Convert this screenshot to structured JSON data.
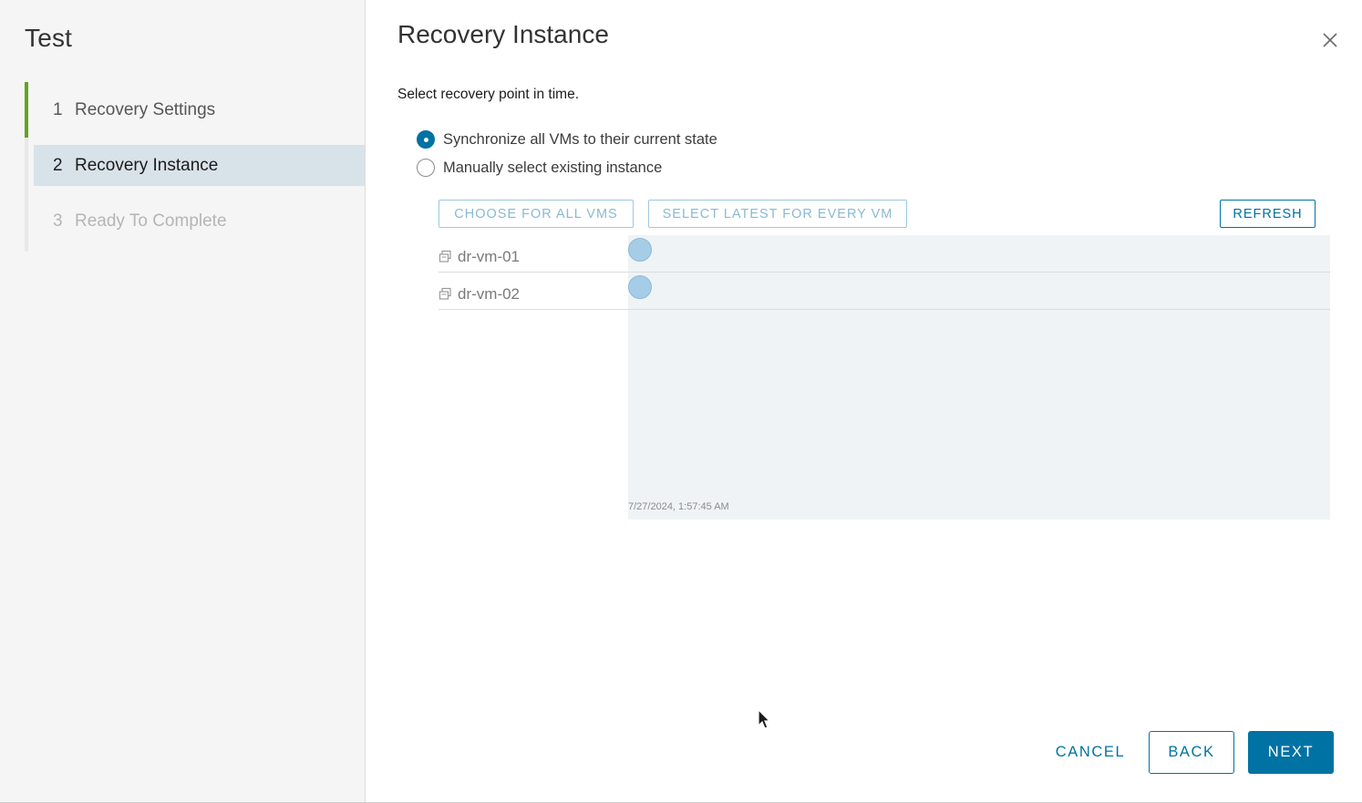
{
  "wizard": {
    "title": "Test",
    "steps": [
      {
        "number": "1",
        "label": "Recovery Settings",
        "state": "completed"
      },
      {
        "number": "2",
        "label": "Recovery Instance",
        "state": "current"
      },
      {
        "number": "3",
        "label": "Ready To Complete",
        "state": "disabled"
      }
    ]
  },
  "main": {
    "title": "Recovery Instance",
    "close_icon": "close-icon",
    "instruction": "Select recovery point in time.",
    "options": [
      {
        "label": "Synchronize all VMs to their current state",
        "checked": true
      },
      {
        "label": "Manually select existing instance",
        "checked": false
      }
    ],
    "toolbar": {
      "choose_all": "CHOOSE FOR ALL VMS",
      "select_latest": "SELECT LATEST FOR EVERY VM",
      "refresh": "REFRESH"
    },
    "vms": [
      {
        "name": "dr-vm-01",
        "icon": "vm-icon"
      },
      {
        "name": "dr-vm-02",
        "icon": "vm-icon"
      }
    ],
    "timeline_label": "7/27/2024, 1:57:45 AM"
  },
  "footer": {
    "cancel": "CANCEL",
    "back": "BACK",
    "next": "NEXT"
  },
  "colors": {
    "accent": "#0072a3",
    "completed_step": "#62a420",
    "current_step_bg": "#d8e3e9",
    "timeline_bg": "#eff3f6",
    "point": "#a6cde7"
  }
}
